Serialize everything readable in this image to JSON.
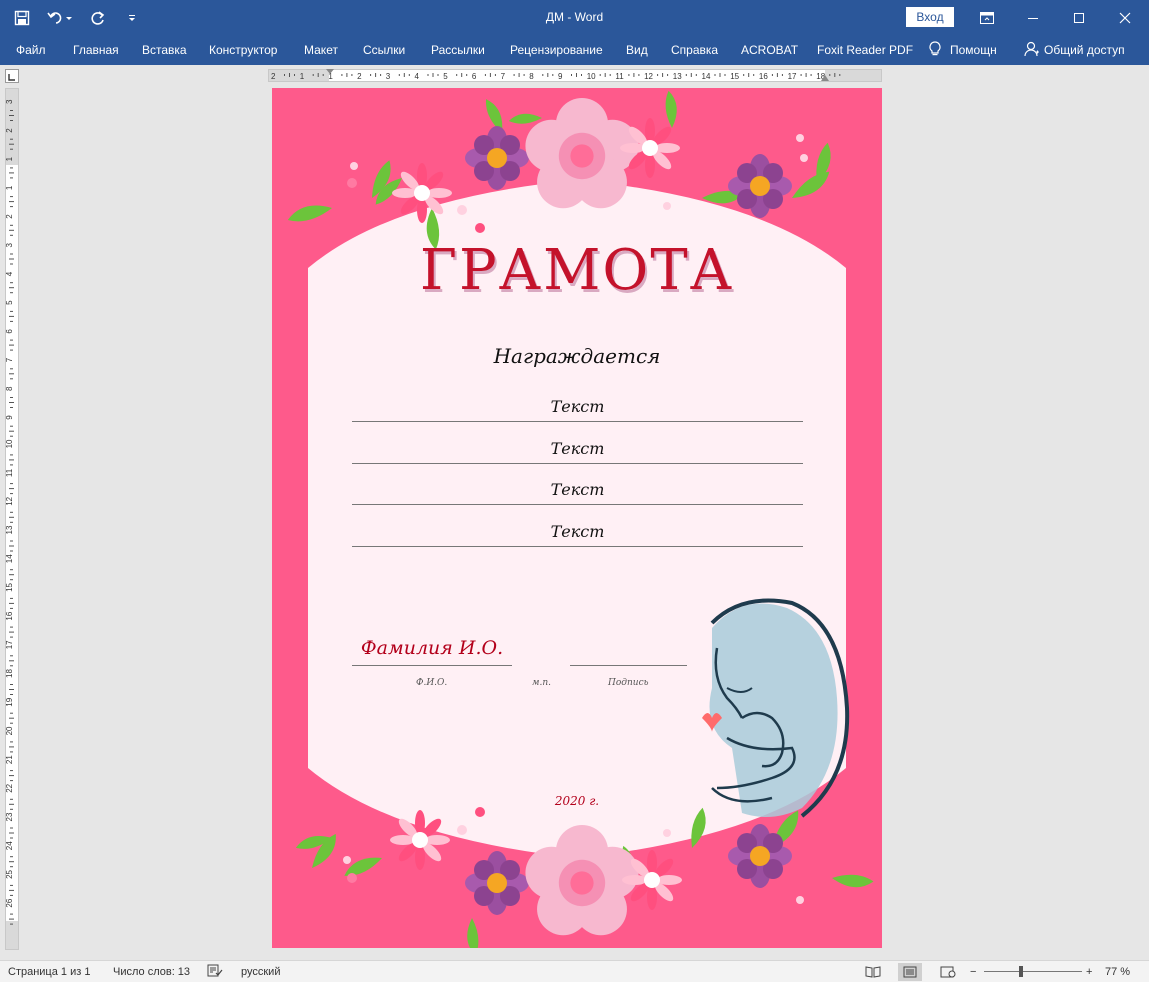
{
  "window": {
    "title": "ДМ  -  Word",
    "signin_label": "Вход"
  },
  "ribbon": {
    "tabs": [
      "Файл",
      "Главная",
      "Вставка",
      "Конструктор",
      "Макет",
      "Ссылки",
      "Рассылки",
      "Рецензирование",
      "Вид",
      "Справка",
      "ACROBAT",
      "Foxit Reader PDF"
    ],
    "tell_me": "Помощн",
    "share": "Общий доступ"
  },
  "ruler": {
    "h_numbers": [
      "2",
      "1",
      "1",
      "2",
      "3",
      "4",
      "5",
      "6",
      "7",
      "8",
      "9",
      "10",
      "11",
      "12",
      "13",
      "14",
      "15",
      "16",
      "17",
      "18"
    ],
    "v_numbers": [
      "3",
      "2",
      "1",
      "1",
      "2",
      "3",
      "4",
      "5",
      "6",
      "7",
      "8",
      "9",
      "10",
      "11",
      "12",
      "13",
      "14",
      "15",
      "16",
      "17",
      "18",
      "19",
      "20",
      "21",
      "22",
      "23",
      "24",
      "25",
      "26"
    ]
  },
  "document": {
    "title": "ГРАМОТА",
    "awarded": "Награждается",
    "text_lines": [
      "Текст",
      "Текст",
      "Текст",
      "Текст"
    ],
    "fio_value": "Фамилия И.О.",
    "captions": {
      "fio": "Ф.И.О.",
      "stamp": "м.п.",
      "signature": "Подпись"
    },
    "year": "2020 г.",
    "colors": {
      "background": "#fe5a8b",
      "panel": "#fff0f5",
      "title": "#c4122b"
    }
  },
  "status": {
    "page": "Страница 1 из 1",
    "words": "Число слов: 13",
    "language": "русский",
    "zoom": "77 %"
  }
}
